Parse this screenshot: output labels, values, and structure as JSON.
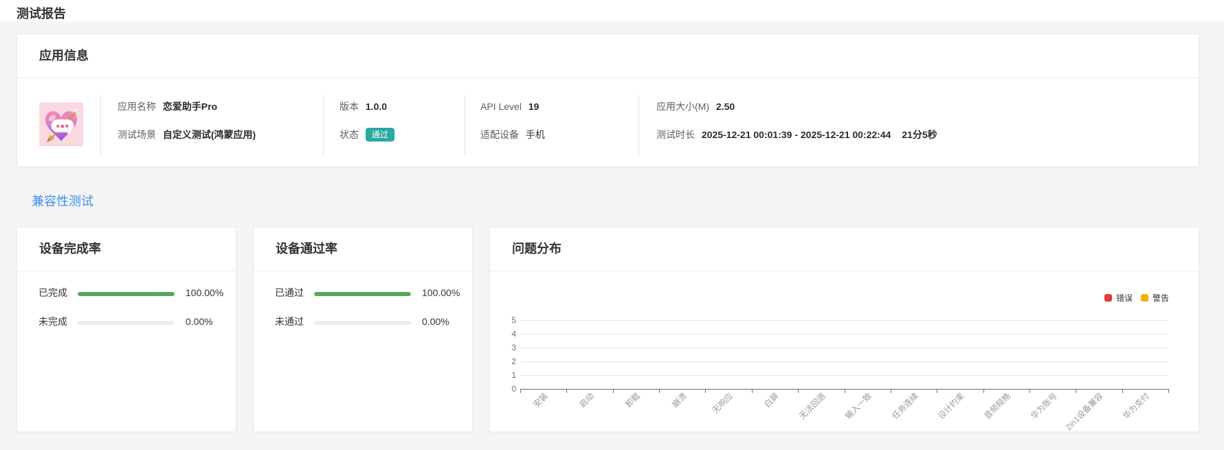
{
  "page": {
    "title": "测试报告"
  },
  "colors": {
    "accent_blue": "#3d8de8",
    "badge_teal": "#2aa8a2",
    "progress_green": "#57a85f",
    "progress_track": "#e9edf4",
    "error_red": "#e23c39",
    "warning_yellow": "#f0b30e"
  },
  "app_info": {
    "title": "应用信息",
    "icon": "love-chat-heart-arrow-app-icon",
    "name": {
      "label": "应用名称",
      "value": "恋爱助手Pro"
    },
    "scenario": {
      "label": "测试场景",
      "value": "自定义测试(鸿蒙应用)"
    },
    "version": {
      "label": "版本",
      "value": "1.0.0"
    },
    "status": {
      "label": "状态",
      "value": "通过"
    },
    "api_level": {
      "label": "API Level",
      "value": "19"
    },
    "device": {
      "label": "适配设备",
      "value": "手机"
    },
    "size": {
      "label": "应用大小(M)",
      "value": "2.50"
    },
    "duration": {
      "label": "测试时长",
      "value": "2025-12-21 00:01:39 - 2025-12-21 00:22:44",
      "total": "21分5秒"
    }
  },
  "section": {
    "title": "兼容性测试"
  },
  "completion_card": {
    "title": "设备完成率",
    "rows": [
      {
        "label": "已完成",
        "value": "100.00%",
        "percent": 100
      },
      {
        "label": "未完成",
        "value": "0.00%",
        "percent": 0
      }
    ]
  },
  "pass_card": {
    "title": "设备通过率",
    "rows": [
      {
        "label": "已通过",
        "value": "100.00%",
        "percent": 100
      },
      {
        "label": "未通过",
        "value": "0.00%",
        "percent": 0
      }
    ]
  },
  "issue_card": {
    "title": "问题分布"
  },
  "chart_data": {
    "type": "bar",
    "title": "问题分布",
    "categories": [
      "安装",
      "启动",
      "卸载",
      "崩溃",
      "无响应",
      "白屏",
      "无法回退",
      "输入一致",
      "任务连续",
      "设计约束",
      "音频规格",
      "华为账号",
      "2in1设备兼容",
      "华为支付"
    ],
    "series": [
      {
        "name": "错误",
        "color": "#e23c39",
        "values": [
          0,
          0,
          0,
          0,
          0,
          0,
          0,
          0,
          0,
          0,
          0,
          0,
          0,
          0
        ]
      },
      {
        "name": "警告",
        "color": "#f0b30e",
        "values": [
          0,
          0,
          0,
          0,
          0,
          0,
          0,
          0,
          0,
          0,
          0,
          0,
          0,
          0
        ]
      }
    ],
    "ylim": [
      0,
      5
    ],
    "y_interval": 1,
    "xlabel": "",
    "ylabel": "",
    "grid": true,
    "x_label_rotate": 45,
    "legend_position": "top-right"
  }
}
